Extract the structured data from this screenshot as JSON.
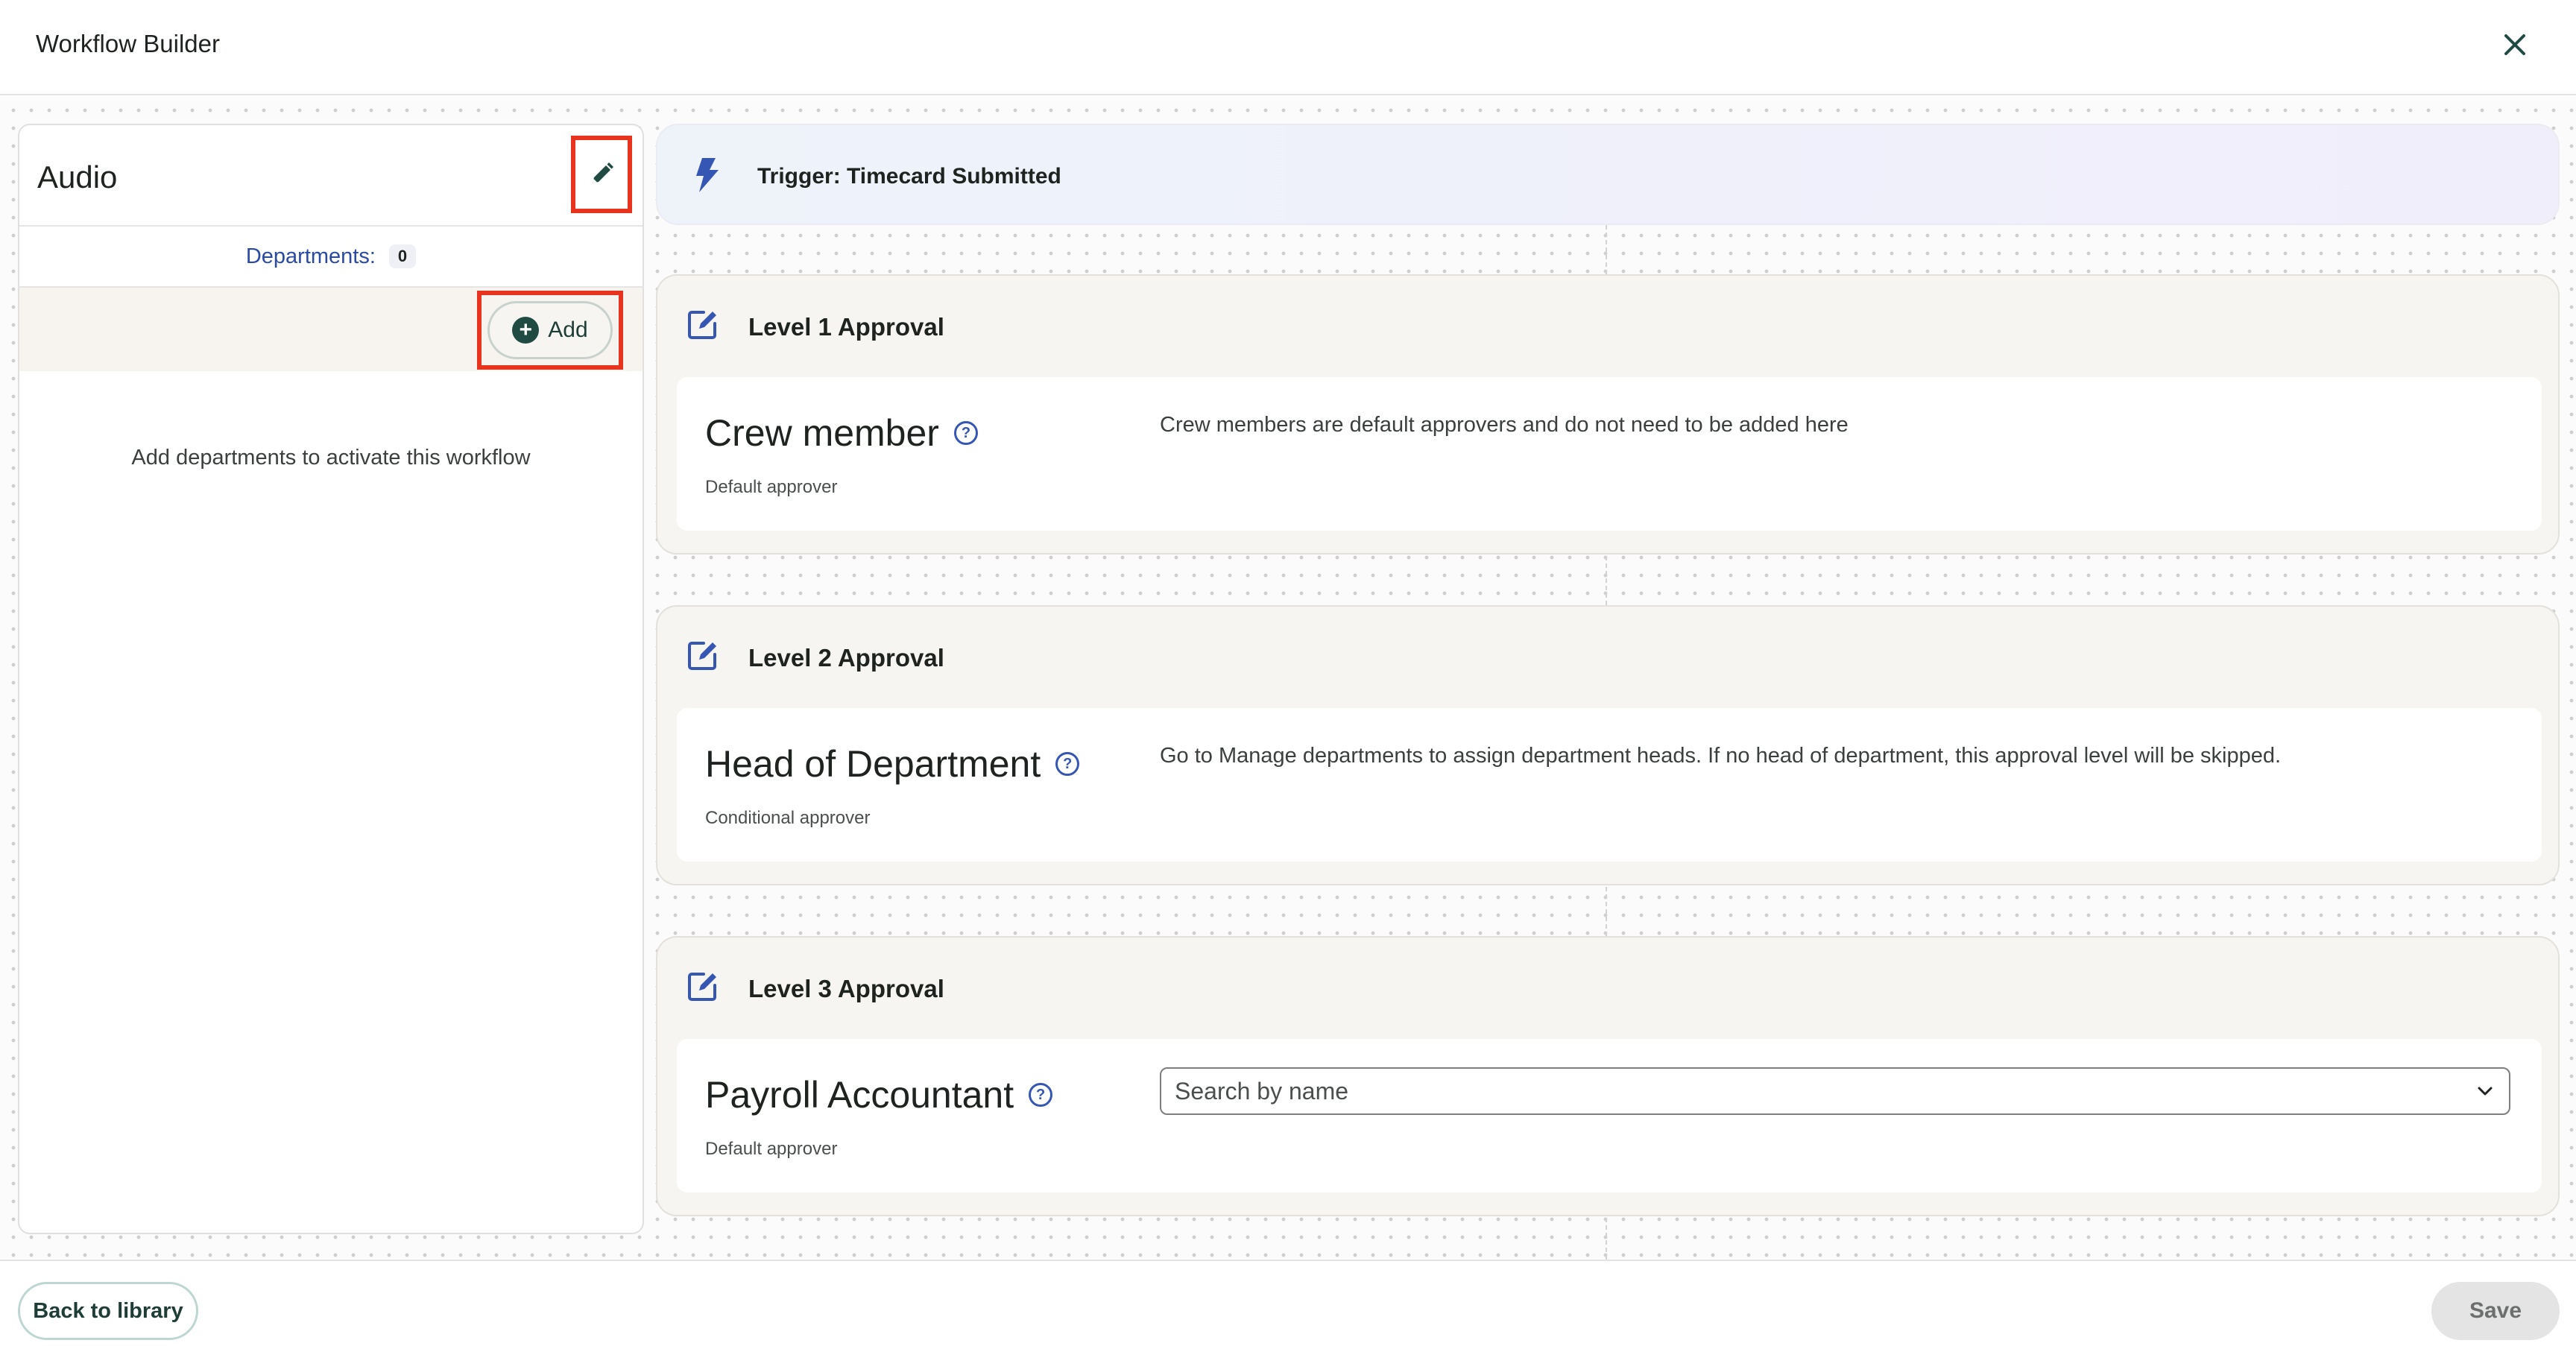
{
  "header": {
    "title": "Workflow Builder",
    "close_icon": "close-icon"
  },
  "left_panel": {
    "title": "Audio",
    "edit_icon": "pencil-icon",
    "departments_label": "Departments:",
    "departments_count": "0",
    "add_label": "Add",
    "empty_message": "Add departments to activate this workflow"
  },
  "trigger": {
    "icon": "lightning-icon",
    "label": "Trigger: Timecard Submitted"
  },
  "levels": [
    {
      "title": "Level 1 Approval",
      "role": "Crew member",
      "subtitle": "Default approver",
      "description": "Crew members are default approvers and do not need to be added here"
    },
    {
      "title": "Level 2 Approval",
      "role": "Head of Department",
      "subtitle": "Conditional approver",
      "description": "Go to Manage departments to assign department heads. If no head of department, this approval level will be skipped."
    },
    {
      "title": "Level 3 Approval",
      "role": "Payroll Accountant",
      "subtitle": "Default approver",
      "search_placeholder": "Search by name"
    }
  ],
  "footer": {
    "back_label": "Back to library",
    "save_label": "Save"
  },
  "colors": {
    "accent_blue": "#3656b3",
    "dark_green": "#1f4b43",
    "highlight_red": "#e8331f",
    "card_bg": "#f7f5f1"
  }
}
